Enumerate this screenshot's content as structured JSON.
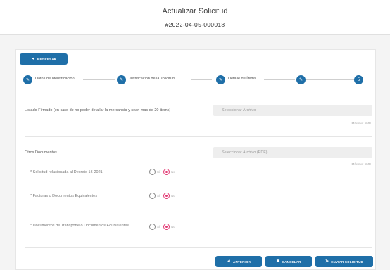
{
  "header": {
    "title": "Actualizar Solicitud",
    "subtitle": "#2022-04-05-000018"
  },
  "buttons": {
    "back": "REGRESAR",
    "previous": "ANTERIOR",
    "cancel": "CANCELAR",
    "submit": "ENVIAR SOLICITUD"
  },
  "stepper": {
    "steps": [
      {
        "label": "Datos de Identificación",
        "icon": "pencil-icon"
      },
      {
        "label": "Justificación de la solicitud",
        "icon": "pencil-icon"
      },
      {
        "label": "Detalle de Ítems",
        "icon": "pencil-icon"
      },
      {
        "label": "",
        "icon": "pencil-icon"
      },
      {
        "label": "",
        "icon": "step-5"
      }
    ],
    "step5_text": "5"
  },
  "form": {
    "listado_label": "Listado Firmado (en caso de no poder detallar la mercancía y sean mas de 20 ítems)",
    "listado_placeholder": "Seleccionar Archivo",
    "listado_hint": "Máximo: 5MB",
    "otros_label": "Otros Documentos",
    "otros_placeholder": "Seleccionar Archivo (PDF)",
    "otros_hint": "Máximo: 5MB",
    "questions": [
      {
        "label": "* Solicitud relacionada al Decreto 16-2021",
        "selected": "No"
      },
      {
        "label": "* Facturas o Documentos Equivalentes",
        "selected": "No"
      },
      {
        "label": "* Documentos de Transporte o Documentos Equivalentes",
        "selected": "No"
      }
    ],
    "yes_label": "Sí",
    "no_label": "No"
  },
  "colors": {
    "primary": "#1f6fa8",
    "radio_selected": "#e23a74"
  }
}
